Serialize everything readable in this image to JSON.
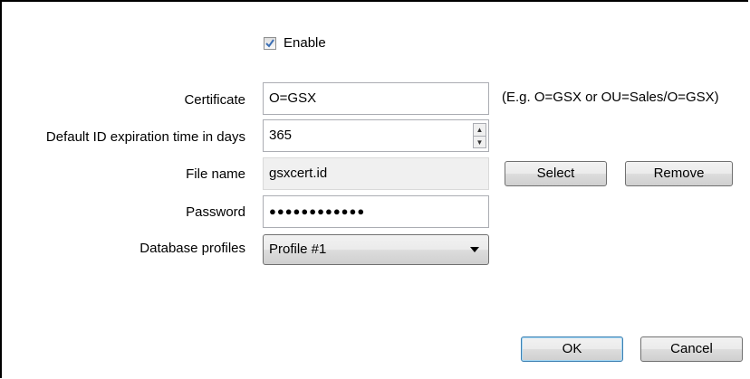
{
  "enable": {
    "label": "Enable",
    "checked": true
  },
  "certificate": {
    "label": "Certificate",
    "value": "O=GSX",
    "hint": "(E.g. O=GSX or OU=Sales/O=GSX)"
  },
  "expiration": {
    "label": "Default ID expiration time in days",
    "value": "365"
  },
  "file": {
    "label": "File name",
    "value": "gsxcert.id",
    "select_label": "Select",
    "remove_label": "Remove"
  },
  "password": {
    "label": "Password",
    "value": "●●●●●●●●●●●●"
  },
  "profiles": {
    "label": "Database profiles",
    "selected": "Profile #1"
  },
  "footer": {
    "ok_label": "OK",
    "cancel_label": "Cancel"
  },
  "icons": {
    "check": "checkmark-icon",
    "caret": "chevron-down-icon",
    "spin_up": "arrow-up-icon",
    "spin_down": "arrow-down-icon"
  }
}
